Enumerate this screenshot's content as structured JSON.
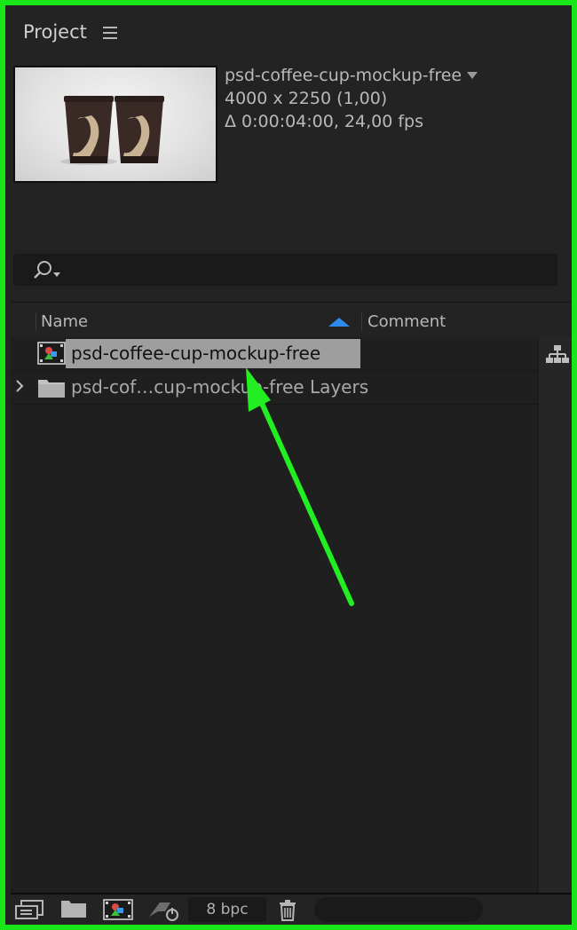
{
  "panel": {
    "title": "Project"
  },
  "selected_item": {
    "name": "psd-coffee-cup-mockup-free",
    "dimensions": "4000 x 2250 (1,00)",
    "duration": "Δ 0:00:04:00, 24,00 fps"
  },
  "search": {
    "placeholder": ""
  },
  "columns": {
    "name": "Name",
    "comment": "Comment",
    "sort": "ascending"
  },
  "items": [
    {
      "label": "psd-coffee-cup-mockup-free",
      "type": "composition",
      "selected": true
    },
    {
      "label": "psd-cof…cup-mockup-free Layers",
      "type": "folder",
      "expanded": false
    }
  ],
  "bottom_bar": {
    "bit_depth": "8 bpc"
  },
  "colors": {
    "frame_outline": "#19e619",
    "annotation_arrow": "#22ee22",
    "sort_arrow": "#2d8ceb",
    "selection": "#9e9e9e"
  },
  "icons": [
    "menu-icon",
    "search-icon",
    "composition-icon",
    "folder-icon",
    "chevron-right-icon",
    "flowchart-icon",
    "interpret-footage-icon",
    "new-folder-icon",
    "new-composition-icon",
    "project-settings-icon",
    "trash-icon"
  ]
}
